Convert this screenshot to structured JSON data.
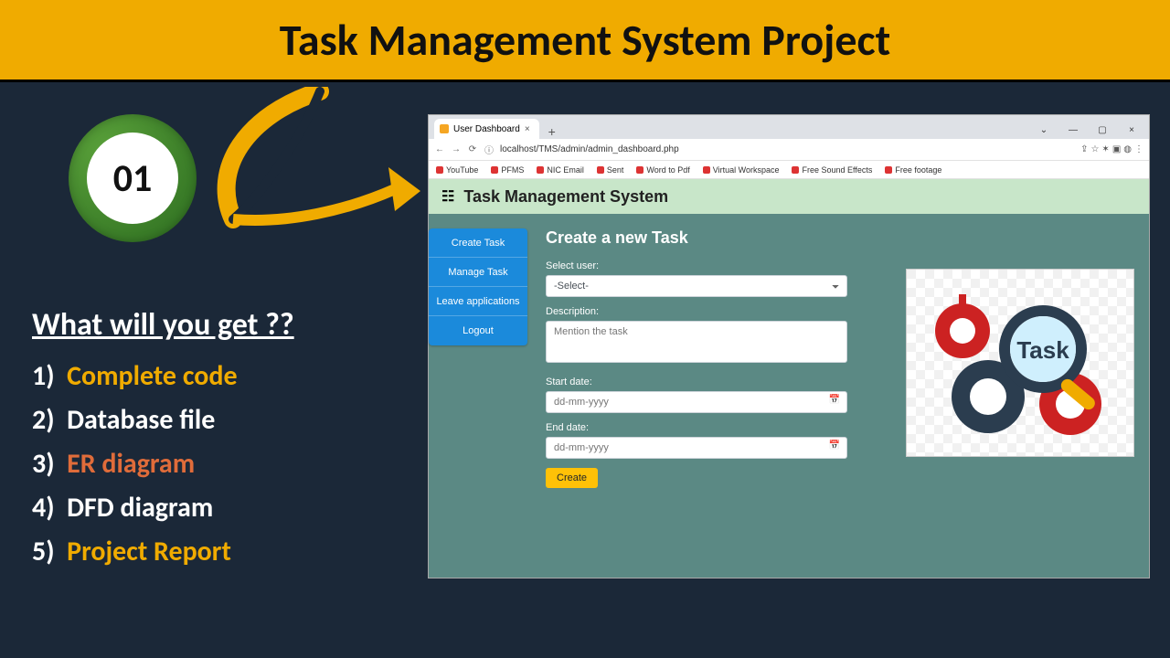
{
  "page_title": "Task Management System Project",
  "badge": "01",
  "left": {
    "heading": "What will you get ??",
    "items": [
      {
        "num": "1)",
        "text": "Complete code",
        "cls": "c-yellow"
      },
      {
        "num": "2)",
        "text": "Database file",
        "cls": "c-white"
      },
      {
        "num": "3)",
        "text": "ER diagram",
        "cls": "c-orange"
      },
      {
        "num": "4)",
        "text": "DFD diagram",
        "cls": "c-white"
      },
      {
        "num": "5)",
        "text": "Project Report",
        "cls": "c-yellow"
      }
    ]
  },
  "browser": {
    "tab_title": "User Dashboard",
    "url": "localhost/TMS/admin/admin_dashboard.php",
    "bookmarks": [
      "YouTube",
      "PFMS",
      "NIC Email",
      "Sent",
      "Word to Pdf",
      "Virtual Workspace",
      "Free Sound Effects",
      "Free footage"
    ]
  },
  "app": {
    "title": "Task Management System",
    "nav": [
      "Create Task",
      "Manage Task",
      "Leave applications",
      "Logout"
    ],
    "form": {
      "heading": "Create a new Task",
      "select_user_label": "Select user:",
      "select_user_value": "-Select-",
      "description_label": "Description:",
      "description_placeholder": "Mention the task",
      "start_label": "Start date:",
      "end_label": "End date:",
      "date_placeholder": "dd-mm-yyyy",
      "submit": "Create"
    },
    "badge_word": "Task"
  }
}
